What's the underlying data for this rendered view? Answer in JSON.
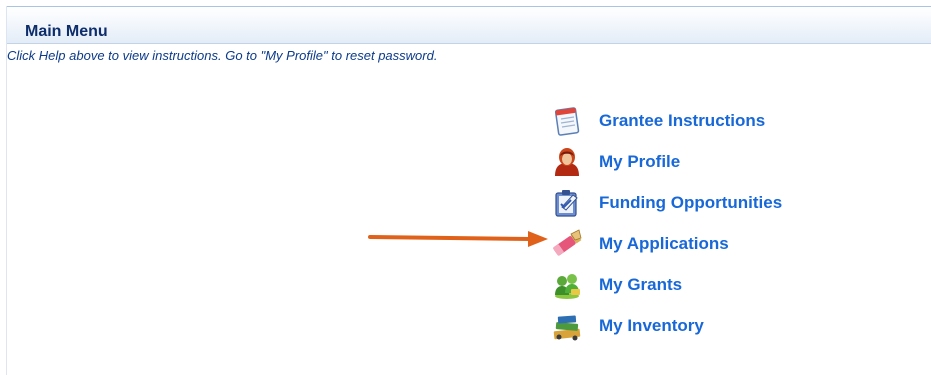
{
  "header": {
    "title": "Main Menu"
  },
  "instructions": "Click Help above to view instructions. Go to \"My Profile\" to reset password.",
  "menu": {
    "items": [
      {
        "label": "Grantee Instructions",
        "icon": "notepad-icon"
      },
      {
        "label": "My Profile",
        "icon": "user-avatar-icon"
      },
      {
        "label": "Funding Opportunities",
        "icon": "clipboard-check-icon"
      },
      {
        "label": "My Applications",
        "icon": "pencil-eraser-icon"
      },
      {
        "label": "My Grants",
        "icon": "people-money-icon"
      },
      {
        "label": "My Inventory",
        "icon": "books-inventory-icon"
      }
    ]
  },
  "colors": {
    "header_text": "#0d2d6b",
    "instruction_text": "#0c3b8a",
    "menu_link": "#1868d8",
    "arrow": "#e0621a"
  }
}
